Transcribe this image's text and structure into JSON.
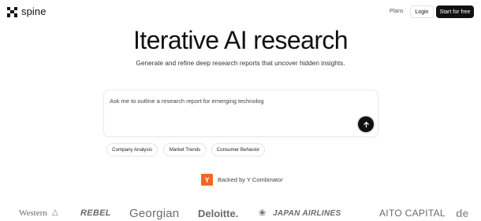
{
  "nav": {
    "brand": "spine",
    "plans_label": "Plans",
    "login_label": "Login",
    "start_label": "Start for free"
  },
  "hero": {
    "title": "Iterative AI research",
    "subtitle": "Generate and refine deep research reports that uncover hidden insights."
  },
  "prompt": {
    "value": "Ask me to outline a research report for emerging technolog",
    "send_icon": "arrow-up-icon"
  },
  "suggestions": [
    {
      "label": "Company Analysis"
    },
    {
      "label": "Market Trends"
    },
    {
      "label": "Consumer Behavior"
    }
  ],
  "backed": {
    "badge": "Y",
    "text": "Backed by Y Combinator",
    "color": "#f26625"
  },
  "client_logos": [
    {
      "name": "Western"
    },
    {
      "name": "REBEL"
    },
    {
      "name": "Georgian"
    },
    {
      "name": "Deloitte."
    },
    {
      "name": "JAPAN AIRLINES"
    },
    {
      "name": "AITO CAPITAL"
    },
    {
      "name": "de"
    }
  ]
}
